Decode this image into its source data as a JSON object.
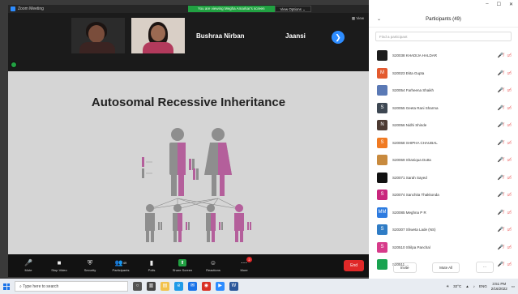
{
  "window": {
    "title": "Zoom Meeting",
    "controls": [
      "–",
      "☐",
      "✕"
    ]
  },
  "share_banner": {
    "message": "You are viewing Megha Amarkar's screen",
    "options_label": "View Options ⌄"
  },
  "gallery": {
    "names": [
      "Bushraa Nirban",
      "Jaansi"
    ],
    "view_label": "▦ View",
    "next_arrow": "❯"
  },
  "slide": {
    "title": "Autosomal Recessive Inheritance",
    "colors": {
      "male": "#8e8e8e",
      "female": "#b45f9b",
      "carrier_male": "#a8a8a8",
      "carrier_female": "#c889b7"
    }
  },
  "toolbar": {
    "buttons": [
      {
        "label": "Mute",
        "icon": "🎤"
      },
      {
        "label": "Stop Video",
        "icon": "■"
      },
      {
        "label": "Security",
        "icon": "⛨"
      },
      {
        "label": "Participants",
        "icon": "👥",
        "count": "49"
      },
      {
        "label": "Polls",
        "icon": "▮"
      },
      {
        "label": "Share Screen",
        "icon": "⬆"
      },
      {
        "label": "Reactions",
        "icon": "☺"
      },
      {
        "label": "More",
        "icon": "⋯",
        "badge": "2"
      }
    ],
    "end_label": "End"
  },
  "participants_panel": {
    "title": "Participants (49)",
    "search_placeholder": "Find a participant",
    "people": [
      {
        "name": "S20038 KHADIJA HALDAR",
        "initial": "",
        "color": "#1c1c1c"
      },
      {
        "name": "S20023 Ekta Gupta",
        "initial": "M",
        "color": "#e35a2f"
      },
      {
        "name": "S20054 Farheena Shaikh",
        "initial": "",
        "color": "#5a79b5"
      },
      {
        "name": "S20055 Geeta Rani Sharma",
        "initial": "S",
        "color": "#3d4752"
      },
      {
        "name": "S20056 Nidhi Shinde",
        "initial": "N",
        "color": "#4d3b33"
      },
      {
        "name": "S20068 SHIPHA CHAUBAL",
        "initial": "S",
        "color": "#f07a22"
      },
      {
        "name": "S20069 Shaniqua Dutta",
        "initial": "",
        "color": "#c88a3e"
      },
      {
        "name": "S20071 Sarah Sayed",
        "initial": "",
        "color": "#111111"
      },
      {
        "name": "S20074 Sanchita Thakkonda",
        "initial": "S",
        "color": "#c9267d"
      },
      {
        "name": "S20085 Meghna P R",
        "initial": "MM",
        "color": "#2d7be0"
      },
      {
        "name": "S20307 Shweta Lade (NS)",
        "initial": "S",
        "color": "#2f7cc5"
      },
      {
        "name": "S20510 Shilpa Panchal",
        "initial": "S",
        "color": "#d73b8a"
      },
      {
        "name": "S20511 ...",
        "initial": "",
        "color": "#19a350"
      }
    ],
    "footer": {
      "invite": "Invite",
      "mute_all": "Mute All",
      "more": "⋯"
    }
  },
  "taskbar": {
    "search_placeholder": "Type here to search",
    "weather": "32°C",
    "lang": "ENG",
    "time": "3:51 PM",
    "date": "2/16/2022"
  }
}
